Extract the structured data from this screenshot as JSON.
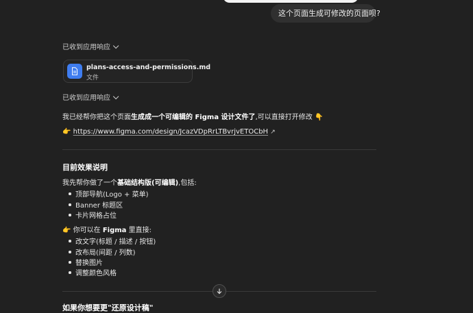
{
  "user_message": {
    "text": "这个页面生成可修改的页面呗?"
  },
  "response_toggle_1": {
    "label": "已收到应用响应"
  },
  "file_card": {
    "name": "plans-access-and-permissions.md",
    "type": "文件",
    "icon": "document-icon",
    "icon_color": "#3f7df0"
  },
  "response_toggle_2": {
    "label": "已收到应用响应"
  },
  "intro": {
    "prefix": "我已经帮你把这个页面",
    "bold": "生成成一个可编辑的 Figma 设计文件了",
    "suffix": ",可以直接打开修改",
    "emoji": "👇"
  },
  "figma_link": {
    "pointer": "👉",
    "url": "https://www.figma.com/design/JcazVDpRrLTBvrjvETOCbH",
    "external_icon": "↗"
  },
  "section_effect": {
    "heading": "目前效果说明",
    "intro_prefix": "我先帮你做了一个",
    "intro_bold": "基础结构版(可编辑)",
    "intro_suffix": ",包括:",
    "items": [
      "顶部导航(Logo + 菜单)",
      "Banner 标题区",
      "卡片网格占位"
    ]
  },
  "section_figma": {
    "pointer": "👉",
    "intro_prefix": "你可以在 ",
    "intro_bold": "Figma",
    "intro_suffix": " 里直接:",
    "items": [
      "改文字(标题 / 描述 / 按钮)",
      "改布局(间距 / 列数)",
      "替换图片",
      "调整颜色风格"
    ]
  },
  "section_restore": {
    "heading": "如果你想要更\"还原设计稿\""
  },
  "colors": {
    "background": "#212121",
    "bubble": "#303030",
    "accent": "#3f7df0",
    "text": "#ececec"
  }
}
